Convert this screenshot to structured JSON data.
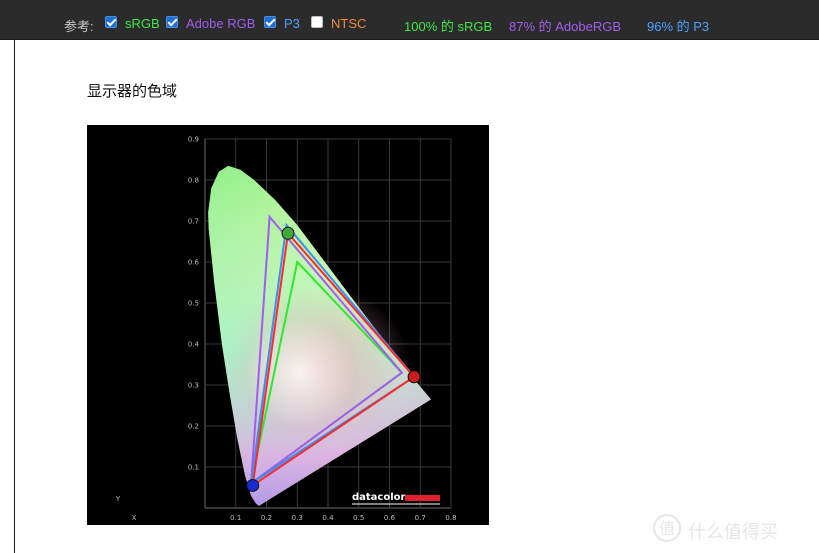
{
  "toolbar": {
    "ref_label": "参考:",
    "options": [
      {
        "label": "sRGB",
        "checked": true,
        "color": "#3ee84a"
      },
      {
        "label": "Adobe RGB",
        "checked": true,
        "color": "#a55cf0"
      },
      {
        "label": "P3",
        "checked": true,
        "color": "#4aa3ff"
      },
      {
        "label": "NTSC",
        "checked": false,
        "color": "#f08a3c"
      }
    ],
    "stats": [
      {
        "text": "100% 的 sRGB",
        "color": "#3ee84a"
      },
      {
        "text": "87% 的 AdobeRGB",
        "color": "#a55cf0"
      },
      {
        "text": "96% 的 P3",
        "color": "#4aa3ff"
      }
    ]
  },
  "main": {
    "title": "显示器的色域"
  },
  "chart_data": {
    "type": "scatter",
    "xlabel": "X",
    "ylabel": "Y",
    "xlim": [
      0,
      0.8
    ],
    "ylim": [
      0,
      0.9
    ],
    "x_ticks": [
      "0.1",
      "0.2",
      "0.3",
      "0.4",
      "0.5",
      "0.6",
      "0.7",
      "0.8"
    ],
    "y_ticks": [
      "0.1",
      "0.2",
      "0.3",
      "0.4",
      "0.5",
      "0.6",
      "0.7",
      "0.8",
      "0.9"
    ],
    "grid": true,
    "brand": "datacolor",
    "series": [
      {
        "points": [
          [
            0.64,
            0.33
          ],
          [
            0.3,
            0.6
          ],
          [
            0.15,
            0.06
          ]
        ],
        "color": "#2ee82e"
      },
      {
        "points": [
          [
            0.64,
            0.33
          ],
          [
            0.21,
            0.71
          ],
          [
            0.15,
            0.06
          ]
        ],
        "color": "#a55cf0"
      },
      {
        "points": [
          [
            0.68,
            0.32
          ],
          [
            0.265,
            0.69
          ],
          [
            0.15,
            0.06
          ]
        ],
        "color": "#3a8ff0"
      },
      {
        "points": [
          [
            0.68,
            0.32
          ],
          [
            0.27,
            0.67
          ],
          [
            0.155,
            0.055
          ]
        ],
        "color": "#ff2a2a"
      }
    ]
  },
  "watermark": {
    "text": "什么值得买"
  }
}
